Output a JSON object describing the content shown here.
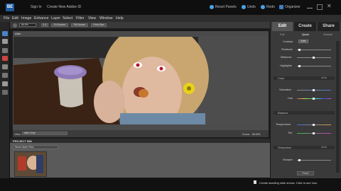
{
  "app": {
    "logo": "BE",
    "sign_in": "Sign In",
    "create_id": "Create New Adobe ID"
  },
  "toolbar": {
    "reset_panels": "Reset Panels",
    "undo": "Undo",
    "redo": "Redo",
    "organizer": "Organizer"
  },
  "menu": [
    "File",
    "Edit",
    "Image",
    "Enhance",
    "Layer",
    "Select",
    "Filter",
    "View",
    "Window",
    "Help"
  ],
  "options": {
    "zoom_value": "66.6%",
    "buttons": [
      "1:1",
      "Fit Screen",
      "Fill Screen",
      "Print Size"
    ]
  },
  "document": {
    "title": "After",
    "view_label": "View:",
    "view_value": "After Only",
    "zoom_label": "Zoom:",
    "zoom_value": "66.6%"
  },
  "project_bin": {
    "title": "PROJECT BIN",
    "dropdown": "Show Open Files"
  },
  "panel": {
    "tabs": [
      "Edit",
      "Create",
      "Share"
    ],
    "subtabs": [
      "Full",
      "Quick",
      "Guided"
    ],
    "sliders_top": [
      {
        "label": "Contrast",
        "value": "Auto"
      },
      {
        "label": "Shadows"
      },
      {
        "label": "Midtones"
      },
      {
        "label": "Highlights"
      }
    ],
    "sections": [
      {
        "title": "Color",
        "auto": "Auto",
        "sliders": [
          "Saturation",
          "Hue"
        ]
      },
      {
        "title": "Balance",
        "sliders": [
          "Temperature",
          "Tint"
        ]
      },
      {
        "title": "Sharpness",
        "auto": "Auto",
        "sliders": [
          "Sharpen"
        ]
      }
    ],
    "reset_label": "Reset"
  },
  "status": {
    "message": "Create dazzling slide shows. Click to see how."
  },
  "colors": {
    "accent": "#1d5b9e",
    "panel_bg": "#3a3a3a"
  }
}
